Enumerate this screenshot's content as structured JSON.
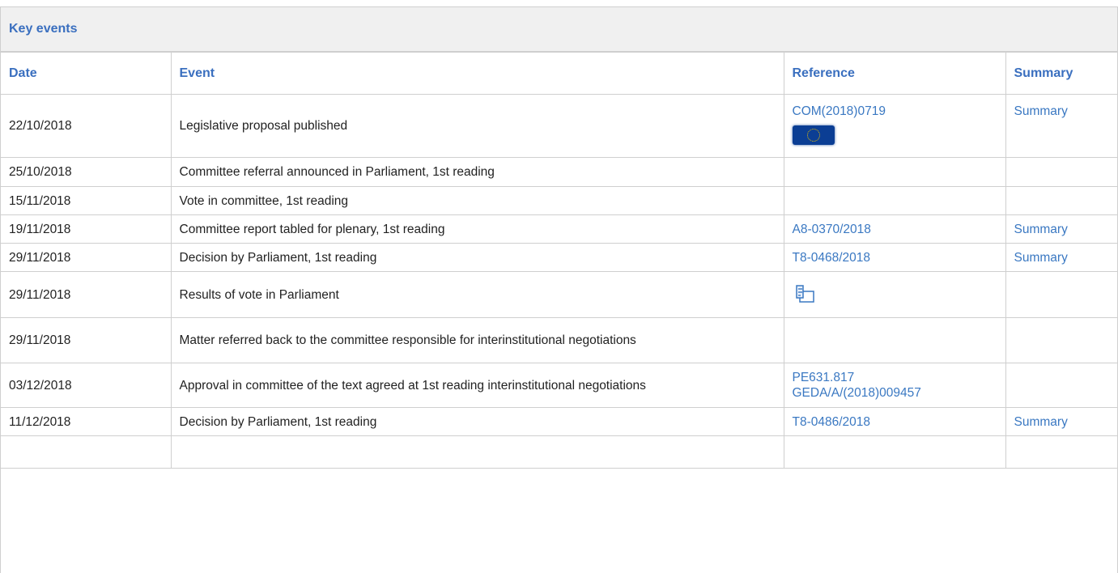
{
  "panel": {
    "title": "Key events"
  },
  "columns": {
    "date": "Date",
    "event": "Event",
    "reference": "Reference",
    "summary": "Summary"
  },
  "icons": {
    "eu_flag": "eu-flag-icon",
    "vote_results": "vote-results-icon"
  },
  "colors": {
    "accent": "#3a6fbf",
    "link": "#3a78c2",
    "border": "#cfcfcf",
    "header_bg": "#f0f0f0"
  },
  "rows": [
    {
      "date": "22/10/2018",
      "event": "Legislative proposal published",
      "ref1": "COM(2018)0719",
      "ref2": "",
      "summary": "Summary"
    },
    {
      "date": "25/10/2018",
      "event": "Committee referral announced in Parliament, 1st reading",
      "ref1": "",
      "ref2": "",
      "summary": ""
    },
    {
      "date": "15/11/2018",
      "event": "Vote in committee, 1st reading",
      "ref1": "",
      "ref2": "",
      "summary": ""
    },
    {
      "date": "19/11/2018",
      "event": "Committee report tabled for plenary, 1st reading",
      "ref1": "A8-0370/2018",
      "ref2": "",
      "summary": "Summary"
    },
    {
      "date": "29/11/2018",
      "event": "Decision by Parliament, 1st reading",
      "ref1": "T8-0468/2018",
      "ref2": "",
      "summary": "Summary"
    },
    {
      "date": "29/11/2018",
      "event": "Results of vote in Parliament",
      "ref1": "",
      "ref2": "",
      "summary": ""
    },
    {
      "date": "29/11/2018",
      "event": "Matter referred back to the committee responsible for interinstitutional negotiations",
      "ref1": "",
      "ref2": "",
      "summary": ""
    },
    {
      "date": "03/12/2018",
      "event": "Approval in committee of the text agreed at 1st reading interinstitutional negotiations",
      "ref1": "PE631.817",
      "ref2": "GEDA/A/(2018)009457",
      "summary": ""
    },
    {
      "date": "11/12/2018",
      "event": "Decision by Parliament, 1st reading",
      "ref1": "T8-0486/2018",
      "ref2": "",
      "summary": "Summary"
    },
    {
      "date": "",
      "event": "",
      "ref1": "",
      "ref2": "",
      "summary": ""
    }
  ]
}
